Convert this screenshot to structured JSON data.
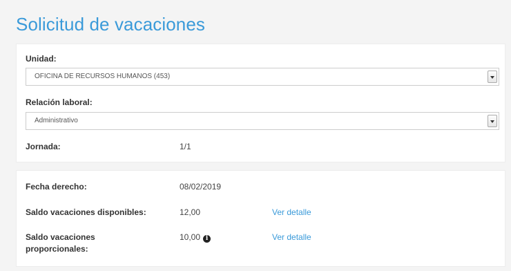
{
  "page": {
    "title": "Solicitud de vacaciones"
  },
  "unidad": {
    "label": "Unidad:",
    "value": "OFICINA DE RECURSOS HUMANOS (453)"
  },
  "relacion": {
    "label": "Relación laboral:",
    "value": "Administrativo"
  },
  "jornada": {
    "label": "Jornada:",
    "value": "1/1"
  },
  "fecha_derecho": {
    "label": "Fecha derecho:",
    "value": "08/02/2019"
  },
  "saldo_disponibles": {
    "label": "Saldo vacaciones disponibles:",
    "value": "12,00",
    "link": "Ver detalle"
  },
  "saldo_proporcionales": {
    "label_line1": "Saldo vacaciones",
    "label_line2": "proporcionales:",
    "value": "10,00",
    "info_icon": "i",
    "link": "Ver detalle"
  },
  "colors": {
    "accent": "#3a9ad9"
  }
}
